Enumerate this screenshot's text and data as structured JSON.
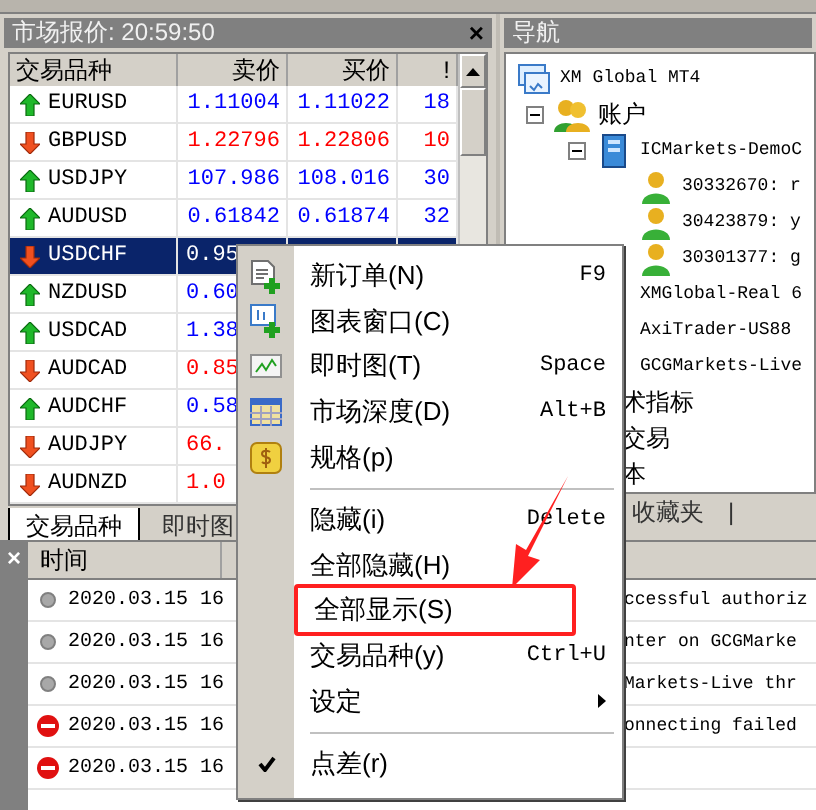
{
  "market_watch": {
    "title": "市场报价: 20:59:50",
    "close": "×",
    "columns": [
      "交易品种",
      "卖价",
      "买价",
      "!"
    ],
    "rows": [
      {
        "symbol": "EURUSD",
        "kind": "up",
        "sell": "1.11004",
        "buy": "1.11022",
        "spread": "18",
        "selected": false
      },
      {
        "symbol": "GBPUSD",
        "kind": "down",
        "sell": "1.22796",
        "buy": "1.22806",
        "spread": "10",
        "selected": false
      },
      {
        "symbol": "USDJPY",
        "kind": "up",
        "sell": "107.986",
        "buy": "108.016",
        "spread": "30",
        "selected": false
      },
      {
        "symbol": "AUDUSD",
        "kind": "up",
        "sell": "0.61842",
        "buy": "0.61874",
        "spread": "32",
        "selected": false
      },
      {
        "symbol": "USDCHF",
        "kind": "down",
        "sell": "0.95",
        "selected": true
      },
      {
        "symbol": "NZDUSD",
        "kind": "up",
        "sell": "0.60",
        "selected": false
      },
      {
        "symbol": "USDCAD",
        "kind": "up",
        "sell": "1.38",
        "selected": false
      },
      {
        "symbol": "AUDCAD",
        "kind": "down",
        "sell": "0.85",
        "selected": false
      },
      {
        "symbol": "AUDCHF",
        "kind": "up",
        "sell": "0.58",
        "selected": false
      },
      {
        "symbol": "AUDJPY",
        "kind": "down",
        "sell": "66.",
        "selected": false
      },
      {
        "symbol": "AUDNZD",
        "kind": "down",
        "sell": "1.0",
        "selected": false
      }
    ],
    "tabs": [
      {
        "label": "交易品种",
        "selected": true
      },
      {
        "label": "即时图",
        "selected": false
      }
    ]
  },
  "navigator": {
    "title": "导航",
    "tree": [
      {
        "label": "XM Global MT4",
        "kind": "terminal",
        "children": [
          {
            "label": "账户",
            "kind": "accounts",
            "expanded": true,
            "children": [
              {
                "label": "ICMarkets-DemoC",
                "kind": "server",
                "expanded": true,
                "children": [
                  {
                    "label": "30332670: r",
                    "kind": "user"
                  },
                  {
                    "label": "30423879: y",
                    "kind": "user"
                  },
                  {
                    "label": "30301377: g",
                    "kind": "user"
                  }
                ]
              },
              {
                "label": "XMGlobal-Real 6"
              },
              {
                "label": "AxiTrader-US88"
              },
              {
                "label": "GCGMarkets-Live"
              }
            ]
          },
          {
            "label": "术指标"
          },
          {
            "label": "交易"
          },
          {
            "label": "本"
          }
        ]
      }
    ],
    "tabs": [
      {
        "label": "收藏夹"
      },
      {
        "label": "|"
      }
    ]
  },
  "terminal": {
    "close": "×",
    "columns": [
      "时间"
    ],
    "rows": [
      {
        "kind": "info",
        "time": "2020.03.15 16",
        "message": "ccessful authoriz"
      },
      {
        "kind": "info",
        "time": "2020.03.15 16",
        "message": "nter on GCGMarke"
      },
      {
        "kind": "info",
        "time": "2020.03.15 16",
        "message": "Markets-Live thr"
      },
      {
        "kind": "error",
        "time": "2020.03.15 16",
        "message": "onnecting failed"
      },
      {
        "kind": "error",
        "time": "2020.03.15 16"
      }
    ]
  },
  "context_menu": [
    {
      "kind": "item",
      "label": "新订单(N)",
      "shortcut": "F9"
    },
    {
      "kind": "item",
      "label": "图表窗口(C)"
    },
    {
      "kind": "item",
      "label": "即时图(T)",
      "shortcut": "Space"
    },
    {
      "kind": "item",
      "label": "市场深度(D)",
      "shortcut": "Alt+B"
    },
    {
      "kind": "item",
      "label": "规格(p)"
    },
    {
      "kind": "separator"
    },
    {
      "kind": "item",
      "label": "隐藏(i)",
      "shortcut": "Delete"
    },
    {
      "kind": "item",
      "label": "全部隐藏(H)"
    },
    {
      "kind": "item",
      "label": "全部显示(S)",
      "highlighted": true
    },
    {
      "kind": "item",
      "label": "交易品种(y)",
      "shortcut": "Ctrl+U"
    },
    {
      "kind": "item",
      "label": "设定",
      "submenu": true
    },
    {
      "kind": "separator"
    },
    {
      "kind": "item",
      "label": "点差(r)",
      "checked": true
    }
  ]
}
